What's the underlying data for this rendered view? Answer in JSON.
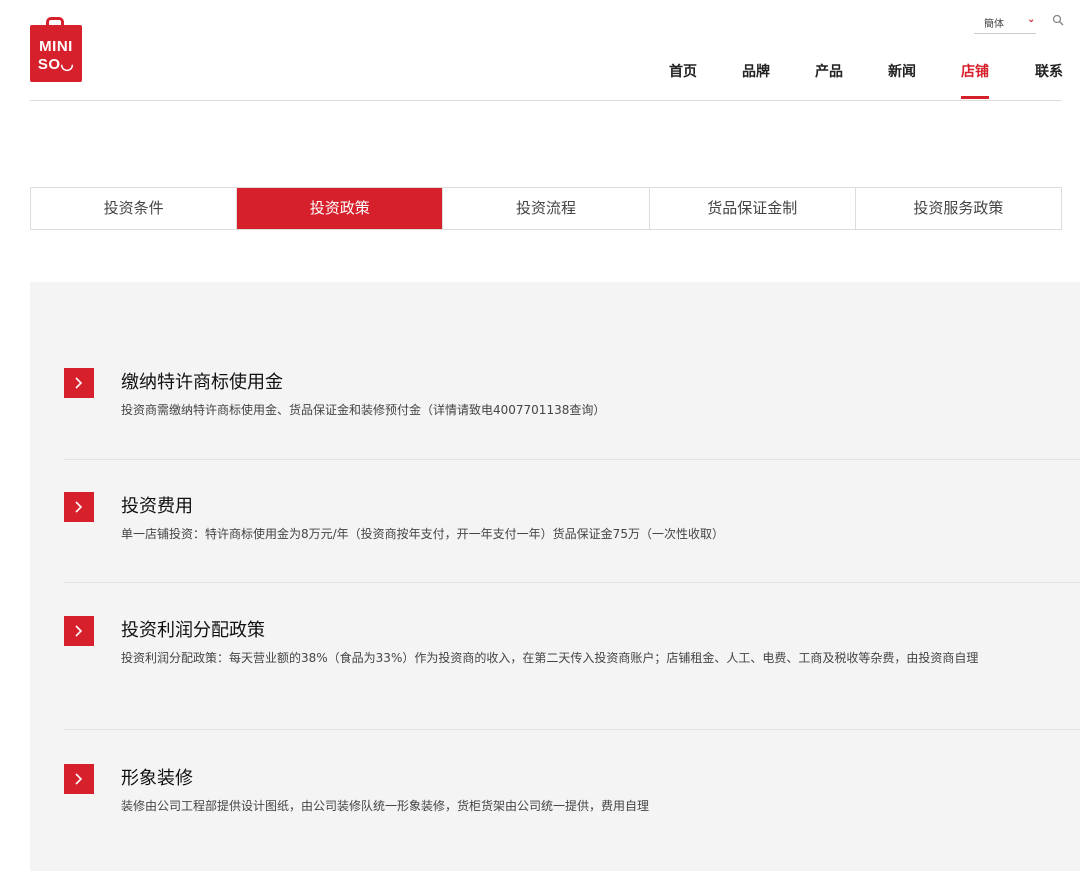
{
  "logo": {
    "line1": "MINI",
    "line2": "SO◡"
  },
  "lang": {
    "label": "簡体"
  },
  "nav": {
    "items": [
      "首页",
      "品牌",
      "产品",
      "新闻",
      "店铺",
      "联系"
    ],
    "active_index": 4
  },
  "tabs": {
    "items": [
      "投资条件",
      "投资政策",
      "投资流程",
      "货品保证金制",
      "投资服务政策"
    ],
    "active_index": 1
  },
  "policies": [
    {
      "title": "缴纳特许商标使用金",
      "desc": "投资商需缴纳特许商标使用金、货品保证金和装修预付金（详情请致电4007701138查询）"
    },
    {
      "title": "投资费用",
      "desc": "单一店铺投资：特许商标使用金为8万元/年（投资商按年支付，开一年支付一年）货品保证金75万（一次性收取）"
    },
    {
      "title": "投资利润分配政策",
      "desc": "投资利润分配政策：每天营业额的38%（食品为33%）作为投资商的收入，在第二天传入投资商账户；店铺租金、人工、电费、工商及税收等杂费，由投资商自理"
    },
    {
      "title": "形象装修",
      "desc": "装修由公司工程部提供设计图纸，由公司装修队统一形象装修，货柜货架由公司统一提供，费用自理"
    }
  ],
  "colors": {
    "brand": "#d6202c",
    "content_bg": "#f4f4f4"
  },
  "icons": {
    "search": "search-icon",
    "lang_dropdown": "chevron-down-icon",
    "row_marker": "chevron-right-icon"
  }
}
